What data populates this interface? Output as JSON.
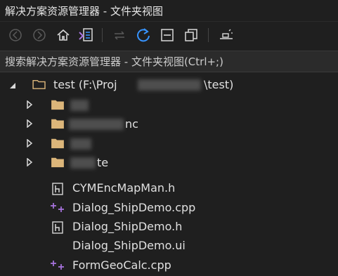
{
  "window": {
    "title": "解决方案资源管理器 - 文件夹视图"
  },
  "search": {
    "placeholder": "搜索解决方案资源管理器 - 文件夹视图(Ctrl+;)"
  },
  "tree": {
    "root": {
      "label": "test (F:\\Proj",
      "label_tail": "\\test)"
    },
    "folders": [
      {
        "label": "",
        "tail": ""
      },
      {
        "label": "",
        "tail": "nc"
      },
      {
        "label": "",
        "tail": ""
      },
      {
        "label": "",
        "tail": "te"
      }
    ],
    "files": [
      {
        "label": "CYMEncMapMan.h",
        "icon": "header-file-icon"
      },
      {
        "label": "Dialog_ShipDemo.cpp",
        "icon": "cpp-file-icon"
      },
      {
        "label": "Dialog_ShipDemo.h",
        "icon": "header-file-icon"
      },
      {
        "label": "Dialog_ShipDemo.ui",
        "icon": "none"
      },
      {
        "label": "FormGeoCalc.cpp",
        "icon": "cpp-file-icon"
      }
    ]
  },
  "colors": {
    "background": "#1f1f1f",
    "accent": "#3794ff",
    "folder": "#dcb67a",
    "cpp": "#a974e0"
  }
}
